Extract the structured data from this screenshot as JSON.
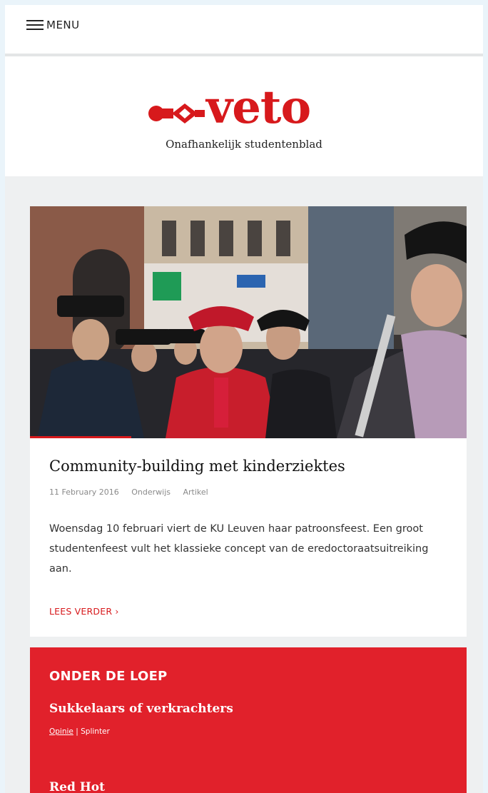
{
  "topbar": {
    "menu_label": "MENU"
  },
  "masthead": {
    "logo_text": "veto",
    "tagline": "Onafhankelijk studentenblad",
    "brand_color": "#d7191c"
  },
  "featured": {
    "title": "Community-building met kinderziektes",
    "date": "11 February 2016",
    "category": "Onderwijs",
    "type": "Artikel",
    "excerpt": "Woensdag 10 februari viert de KU Leuven haar patroonsfeest. Een groot studentenfeest vult het klassieke concept van de eredoctoraatsuitreiking aan.",
    "read_more": "LEES VERDER ›"
  },
  "onder_de_loep": {
    "heading": "ONDER DE LOEP",
    "accent_color": "#e1212b",
    "items": [
      {
        "title": "Sukkelaars of verkrachters",
        "tag1": "Opinie",
        "separator": "|",
        "tag2": "Splinter"
      },
      {
        "title": "Red Hot"
      }
    ]
  }
}
